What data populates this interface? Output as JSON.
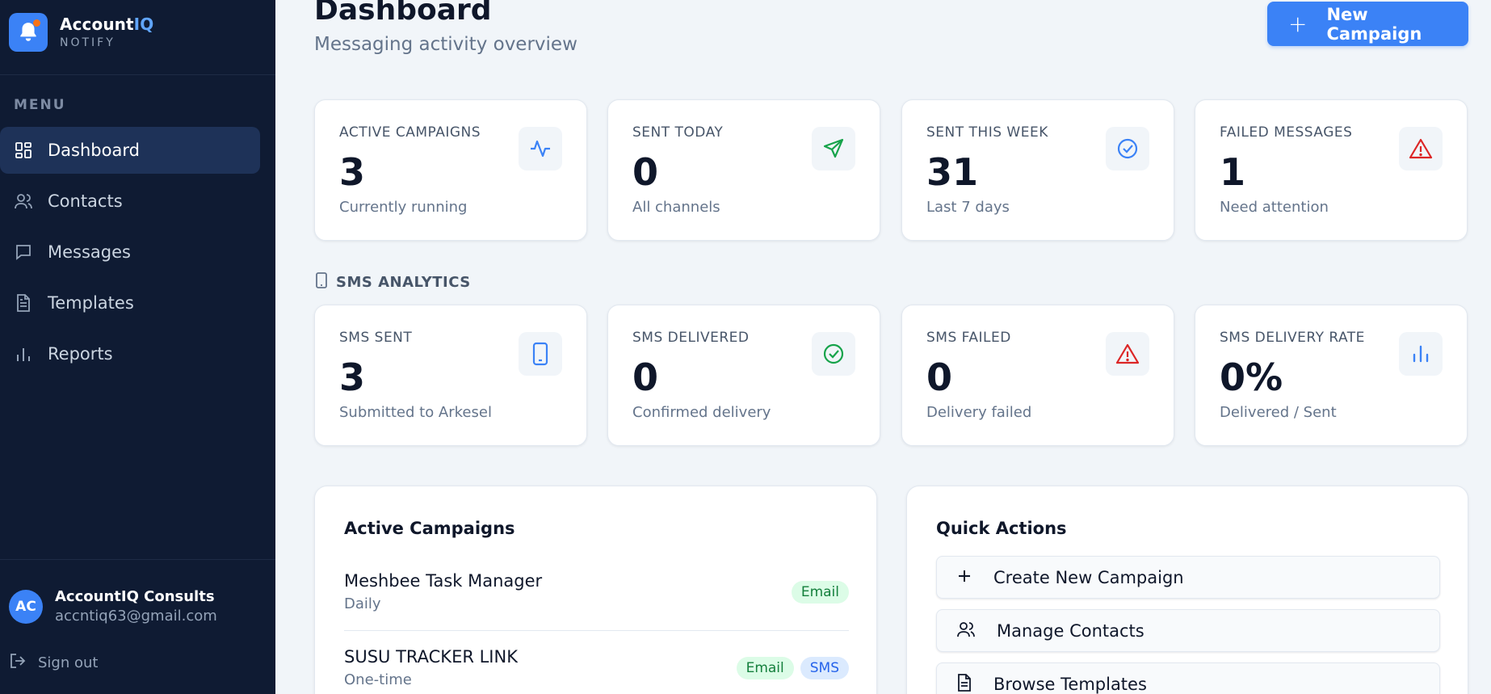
{
  "brand": {
    "name_main": "Account",
    "name_accent": "IQ",
    "subtitle": "NOTIFY"
  },
  "sidebar": {
    "menu_label": "MENU",
    "items": [
      {
        "label": "Dashboard",
        "icon": "dashboard-icon",
        "active": true
      },
      {
        "label": "Contacts",
        "icon": "users-icon",
        "active": false
      },
      {
        "label": "Messages",
        "icon": "message-icon",
        "active": false
      },
      {
        "label": "Templates",
        "icon": "document-icon",
        "active": false
      },
      {
        "label": "Reports",
        "icon": "bar-chart-icon",
        "active": false
      }
    ],
    "user": {
      "initials": "AC",
      "name": "AccountIQ Consults",
      "email": "accntiq63@gmail.com"
    },
    "signout_label": "Sign out"
  },
  "header": {
    "title": "Dashboard",
    "subtitle": "Messaging activity overview",
    "new_campaign_label": "New Campaign"
  },
  "stats": [
    {
      "label": "ACTIVE CAMPAIGNS",
      "value": "3",
      "sub": "Currently running",
      "icon": "activity-icon",
      "color": "#3b82f6"
    },
    {
      "label": "SENT TODAY",
      "value": "0",
      "sub": "All channels",
      "icon": "send-icon",
      "color": "#16a34a"
    },
    {
      "label": "SENT THIS WEEK",
      "value": "31",
      "sub": "Last 7 days",
      "icon": "check-circle-icon",
      "color": "#3b82f6"
    },
    {
      "label": "FAILED MESSAGES",
      "value": "1",
      "sub": "Need attention",
      "icon": "warning-icon",
      "color": "#dc2626"
    }
  ],
  "sms_section": {
    "label": "SMS ANALYTICS",
    "stats": [
      {
        "label": "SMS SENT",
        "value": "3",
        "sub": "Submitted to Arkesel",
        "icon": "phone-icon",
        "color": "#3b82f6"
      },
      {
        "label": "SMS DELIVERED",
        "value": "0",
        "sub": "Confirmed delivery",
        "icon": "check-circle-icon",
        "color": "#16a34a"
      },
      {
        "label": "SMS FAILED",
        "value": "0",
        "sub": "Delivery failed",
        "icon": "warning-icon",
        "color": "#dc2626"
      },
      {
        "label": "SMS DELIVERY RATE",
        "value": "0%",
        "sub": "Delivered / Sent",
        "icon": "bar-chart-icon",
        "color": "#3b82f6"
      }
    ]
  },
  "active_campaigns": {
    "title": "Active Campaigns",
    "items": [
      {
        "name": "Meshbee Task Manager",
        "frequency": "Daily",
        "channels": [
          "Email"
        ]
      },
      {
        "name": "SUSU TRACKER LINK",
        "frequency": "One-time",
        "channels": [
          "Email",
          "SMS"
        ]
      }
    ]
  },
  "quick_actions": {
    "title": "Quick Actions",
    "items": [
      {
        "label": "Create New Campaign",
        "icon": "plus-icon"
      },
      {
        "label": "Manage Contacts",
        "icon": "users-icon"
      },
      {
        "label": "Browse Templates",
        "icon": "document-icon"
      }
    ]
  }
}
